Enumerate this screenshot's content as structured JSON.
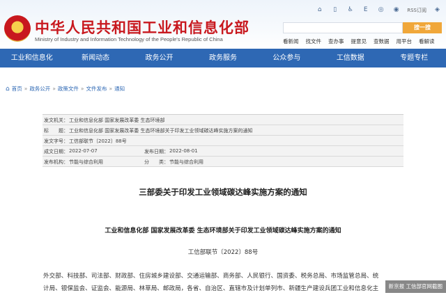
{
  "header": {
    "site_title": "中华人民共和国工业和信息化部",
    "site_subtitle": "Ministry of Industry and Information Technology of the People's Republic of China",
    "rss_label": "RSS订阅",
    "search_placeholder": "",
    "search_button": "搜一搜",
    "quick_links": [
      "看新闻",
      "找文件",
      "查办事",
      "提意见",
      "查数据",
      "用平台",
      "看解读"
    ]
  },
  "nav": {
    "items": [
      "工业和信息化",
      "新闻动态",
      "政务公开",
      "政务服务",
      "公众参与",
      "工信数据",
      "专题专栏"
    ]
  },
  "breadcrumb": [
    "首页",
    "政务公开",
    "政策文件",
    "文件发布",
    "通知"
  ],
  "doc_info": {
    "org_label": "发文机关：",
    "org_value": "工业和信息化部 国家发展改革委 生态环境部",
    "title_label": "标　　题：",
    "title_value": "工业和信息化部 国家发展改革委 生态环境部关于印发工业领域碳达峰实施方案的通知",
    "docno_label": "发文字号：",
    "docno_value": "工信部联节〔2022〕88号",
    "written_label": "成文日期：",
    "written_value": "2022-07-07",
    "published_label": "发布日期：",
    "published_value": "2022-08-01",
    "agency_label": "发布机构：",
    "agency_value": "节能与综合利用",
    "category_label": "分　　类：",
    "category_value": "节能与综合利用"
  },
  "content": {
    "main_title": "三部委关于印发工业领域碳达峰实施方案的通知",
    "sub_title": "工业和信息化部 国家发展改革委 生态环境部关于印发工业领域碳达峰实施方案的通知",
    "doc_number": "工信部联节〔2022〕88号",
    "body_line1": "外交部、科技部、司法部、财政部、住房城乡建设部、交通运输部、商务部、人民银行、国资委、税务总局、市场监管总局、统",
    "body_line2": "计局、银保监会、证监会、能源局、林草局、邮政局，各省、自治区、直辖市及计划单列市、新疆生产建设兵团工业和信息化主"
  },
  "watermark": "新京报 工信部官网截图",
  "colors": {
    "accent_red": "#c8181e",
    "nav_blue": "#2e68b4",
    "search_orange": "#f0a73a"
  }
}
